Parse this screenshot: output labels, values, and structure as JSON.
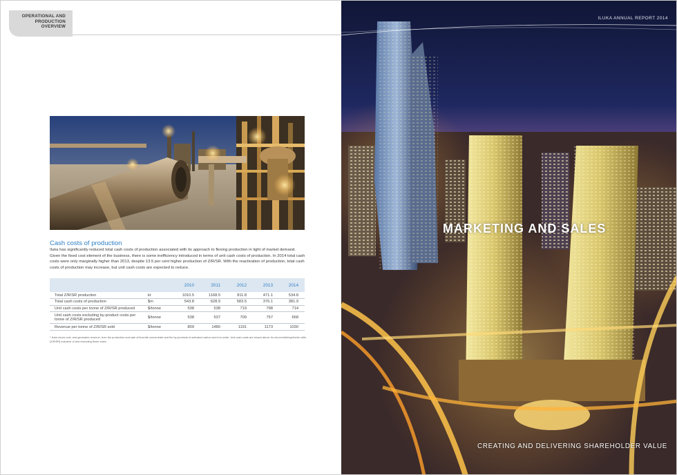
{
  "left_page": {
    "section_tab": {
      "line1": "OPERATIONAL AND",
      "line2": "PRODUCTION",
      "line3": "OVERVIEW"
    },
    "photo": {
      "subject": "mineral sands processing plant at night"
    },
    "heading": "Cash costs of production",
    "body": "Iluka has significantly reduced total cash costs of production associated with its approach to flexing production in light of market demand. Given the fixed cost element of the business, there is some inefficiency introduced in terms of unit cash costs of production. In 2014 total cash costs were only marginally higher than 2013, despite 13.5 per cent higher production of Z/R/SR. With the reactivation of production, total cash costs of production may increase, but unit cash costs are expected to reduce.",
    "table": {
      "headers": [
        "",
        "",
        "2010",
        "2011",
        "2012",
        "2013",
        "2014"
      ],
      "rows": [
        {
          "label": "Total Z/R/SR production",
          "unit": "kt",
          "values": [
            "1010.5",
            "1168.5",
            "811.8",
            "471.1",
            "534.8"
          ]
        },
        {
          "label": "Total cash costs of production",
          "unit": "$m",
          "values": [
            "543.8",
            "628.9",
            "583.5",
            "376.1",
            "381.9"
          ]
        },
        {
          "label": "Unit cash costs per tonne of Z/R/SR produced",
          "unit": "$/tonne",
          "values": [
            "538",
            "538",
            "719",
            "798",
            "714"
          ]
        },
        {
          "label": "Unit cash costs excluding by-product costs per tonne of Z/R/SR produced",
          "unit": "$/tonne",
          "values": [
            "538",
            "537",
            "709",
            "757",
            "668"
          ]
        },
        {
          "label": "Revenue per tonne of Z/R/SR sold",
          "unit": "$/tonne",
          "values": [
            "809",
            "1480",
            "1191",
            "1173",
            "1030"
          ]
        }
      ]
    },
    "footnote": "* Iluka incurs cost, and generates revenue, from the production and sale of ilmenite concentrate and the by-products of activated carbon and iron oxide. Unit cash costs are shown above for zircon/rutile/synthetic rutile (Z/R/SR) inclusive of and excluding those costs."
  },
  "right_page": {
    "report_title": "ILUKA ANNUAL REPORT 2014",
    "photo": {
      "subject": "night aerial view of city skyscrapers"
    },
    "heading": "MARKETING AND SALES",
    "tagline": "CREATING AND DELIVERING SHAREHOLDER VALUE"
  },
  "colors": {
    "accent_blue": "#2e7fc4",
    "table_header_bg": "#dde7f1",
    "tab_grey": "#d9d9d9"
  }
}
